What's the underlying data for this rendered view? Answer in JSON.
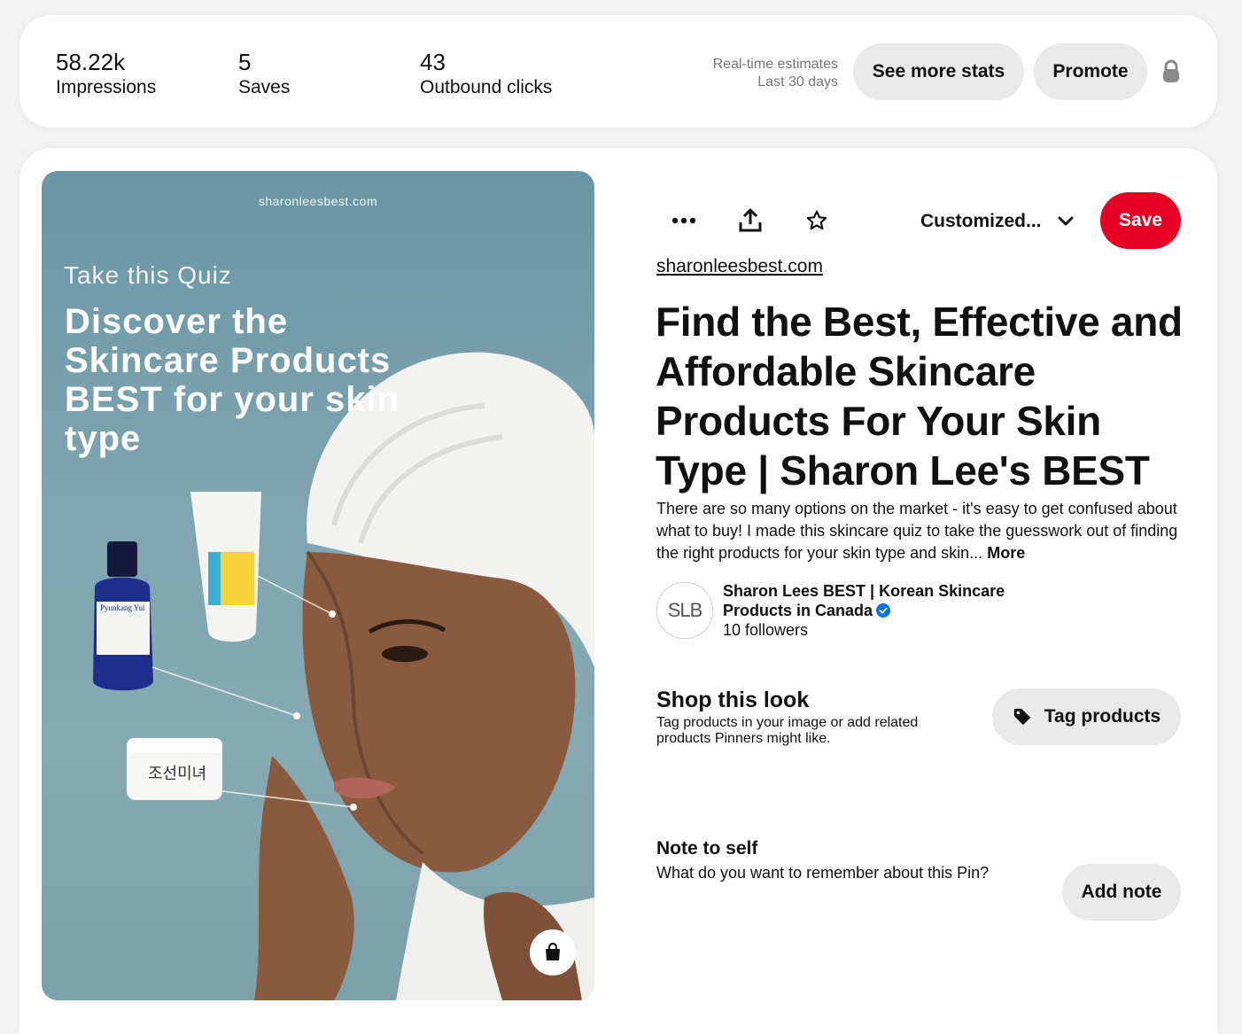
{
  "stats": {
    "items": [
      {
        "value": "58.22k",
        "label": "Impressions"
      },
      {
        "value": "5",
        "label": "Saves"
      },
      {
        "value": "43",
        "label": "Outbound clicks"
      }
    ],
    "estimates_line1": "Real-time estimates",
    "estimates_line2": "Last 30 days",
    "see_more_label": "See more stats",
    "promote_label": "Promote",
    "lock_icon": "lock-icon"
  },
  "pin_image": {
    "site": "sharonleesbest.com",
    "quiz": "Take this Quiz",
    "headline": "Discover the Skincare Products BEST for your skin type",
    "product_labels": [
      "Pyunkang Yul",
      "조선미녀"
    ]
  },
  "toolbar": {
    "board_label": "Customized...",
    "save_label": "Save"
  },
  "pin": {
    "site_link": "sharonleesbest.com",
    "title": "Find the Best, Effective and Affordable Skincare Products For Your Skin Type | Sharon Lee's BEST",
    "description": "There are so many options on the market - it's easy to get confused about what to buy! I made this skincare quiz to take the guesswork out of finding the right products for your skin type and skin...",
    "more_label": "More"
  },
  "creator": {
    "avatar_text": "SLB",
    "name": "Sharon Lees BEST | Korean Skincare Products in Canada",
    "followers": "10 followers"
  },
  "shop": {
    "title": "Shop this look",
    "subtitle": "Tag products in your image or add related products Pinners might like.",
    "tag_label": "Tag products"
  },
  "note": {
    "title": "Note to self",
    "subtitle": "What do you want to remember about this Pin?",
    "button_label": "Add note"
  },
  "colors": {
    "save_red": "#e60023",
    "pill_gray": "#e9e9e9",
    "verified_blue": "#0074e8"
  }
}
